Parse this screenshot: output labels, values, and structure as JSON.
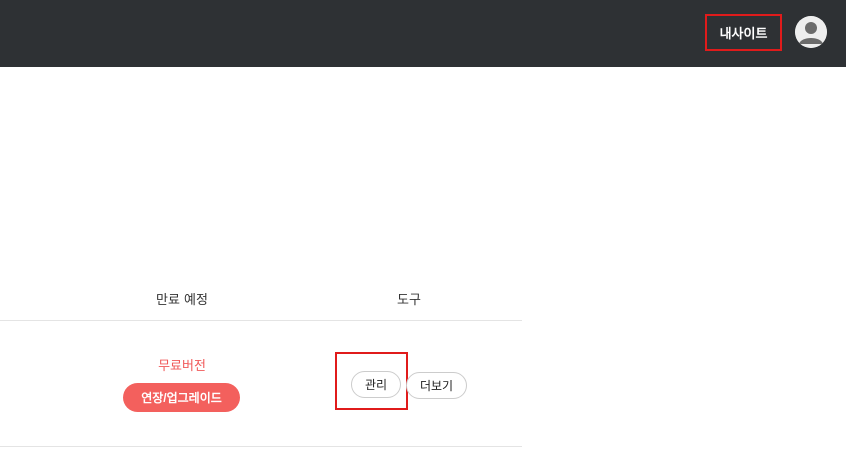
{
  "header": {
    "my_site_label": "내사이트",
    "avatar_icon": "user-avatar-icon",
    "background": "#2e3134"
  },
  "table": {
    "columns": [
      "만료 예정",
      "도구"
    ],
    "row": {
      "plan_label": "무료버전",
      "upgrade_label": "연장/업그레이드",
      "manage_label": "관리",
      "more_label": "더보기"
    }
  },
  "colors": {
    "accent_red": "#f3605d",
    "highlight_box": "#e01b1b"
  }
}
